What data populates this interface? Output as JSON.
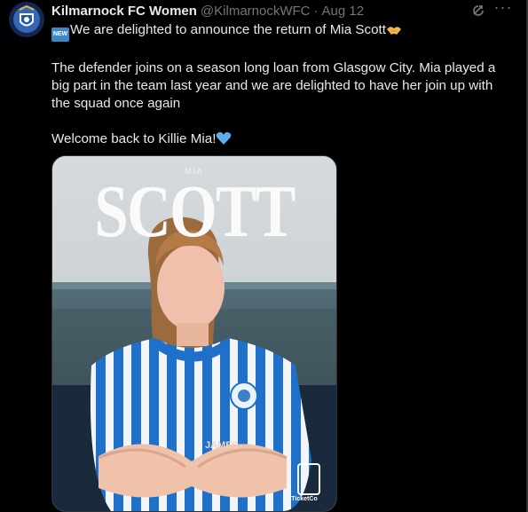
{
  "tweet": {
    "display_name": "Kilmarnock FC Women",
    "handle": "@KilmarnockWFC",
    "separator": "·",
    "date": "Aug 12",
    "more_label": "···",
    "lines": [
      "We are delighted to announce the return of Mia Scott",
      "The defender joins on a season long loan from Glasgow City. Mia played a",
      "big part in the team last year and we are delighted to have her join up with",
      "the squad once again",
      "Welcome back to Killie Mia!"
    ],
    "new_badge": "NEW",
    "icons": {
      "new": "new-button-emoji",
      "handshake": "handshake-emoji",
      "heart": "blue-heart-emoji",
      "grok": "grok-icon",
      "more": "more-icon",
      "avatar": "club-crest-avatar"
    }
  },
  "media": {
    "first_name": "MIA",
    "surname": "SCOTT",
    "shirt_text": "JAMES",
    "sponsor_name": "TicketCo"
  },
  "colors": {
    "background": "#000000",
    "text": "#e7e9ea",
    "muted": "#71767b",
    "shirt_blue": "#1f70c9"
  }
}
